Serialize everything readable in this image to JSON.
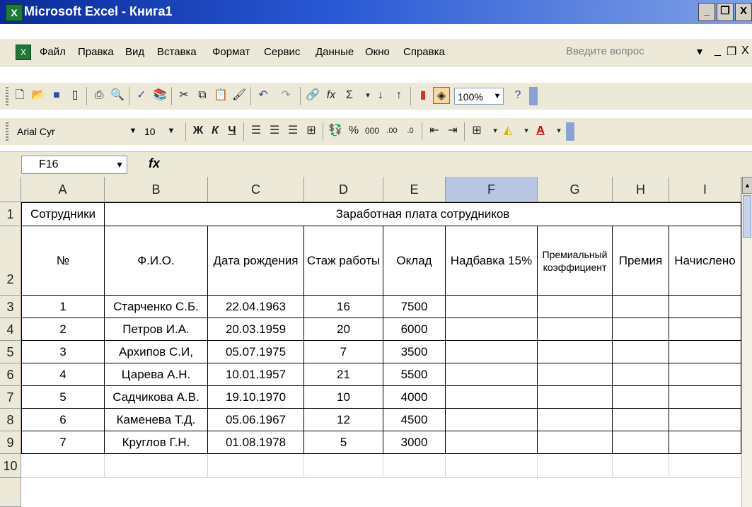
{
  "window": {
    "title": "Microsoft Excel - Книга1"
  },
  "menu": {
    "items": [
      "Файл",
      "Правка",
      "Вид",
      "Вставка",
      "Формат",
      "Сервис",
      "Данные",
      "Окно",
      "Справка"
    ],
    "help_placeholder": "Введите вопрос"
  },
  "toolbar": {
    "zoom": "100%",
    "font_name": "Arial Cyr",
    "font_size": "10",
    "bold": "Ж",
    "italic": "К",
    "underline": "Ч",
    "percent": "%",
    "thousands": "000",
    "fx": "fx",
    "sigma": "Σ"
  },
  "formula_bar": {
    "name_box": "F16",
    "fx_label": "fx"
  },
  "grid": {
    "columns": [
      "A",
      "B",
      "C",
      "D",
      "E",
      "F",
      "G",
      "H",
      "I"
    ],
    "selected_column": "F",
    "rows": [
      "1",
      "2",
      "3",
      "4",
      "5",
      "6",
      "7",
      "8",
      "9",
      "10"
    ],
    "row1": {
      "a": "Сотрудники",
      "title": "Заработная плата сотрудников"
    },
    "headers": [
      "№",
      "Ф.И.О.",
      "Дата рождения",
      "Стаж работы",
      "Оклад",
      "Надбавка 15%",
      "Премиальный коэффициент",
      "Премия",
      "Начислено"
    ],
    "data": [
      [
        "1",
        "Старченко С.Б.",
        "22.04.1963",
        "16",
        "7500"
      ],
      [
        "2",
        "Петров И.А.",
        "20.03.1959",
        "20",
        "6000"
      ],
      [
        "3",
        "Архипов С.И,",
        "05.07.1975",
        "7",
        "3500"
      ],
      [
        "4",
        "Царева А.Н.",
        "10.01.1957",
        "21",
        "5500"
      ],
      [
        "5",
        "Садчикова А.В.",
        "19.10.1970",
        "10",
        "4000"
      ],
      [
        "6",
        "Каменева Т.Д.",
        "05.06.1967",
        "12",
        "4500"
      ],
      [
        "7",
        "Круглов Г.Н.",
        "01.08.1978",
        "5",
        "3000"
      ]
    ]
  }
}
